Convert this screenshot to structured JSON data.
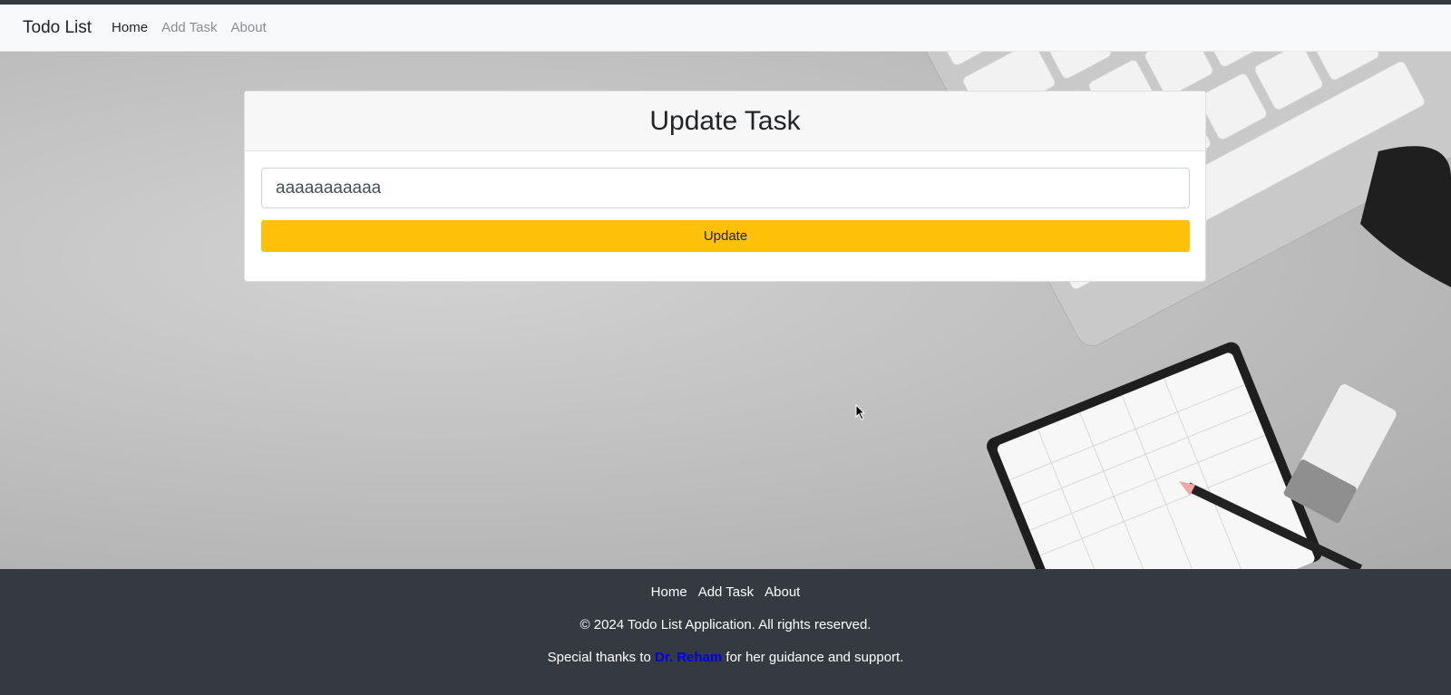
{
  "navbar": {
    "brand": "Todo List",
    "links": [
      "Home",
      "Add Task",
      "About"
    ]
  },
  "card": {
    "title": "Update Task",
    "input_value": "aaaaaaaaaaa",
    "button_label": "Update"
  },
  "footer": {
    "links": [
      "Home",
      "Add Task",
      "About"
    ],
    "copyright": "© 2024 Todo List Application. All rights reserved.",
    "thanks_before": "Special thanks to",
    "thanks_link": "Dr. Reham",
    "thanks_after": "for her guidance and support."
  },
  "colors": {
    "accent": "#ffc107",
    "footer_bg": "#343a40",
    "navbar_bg": "#f8f9fa",
    "link": "#0000ee"
  }
}
